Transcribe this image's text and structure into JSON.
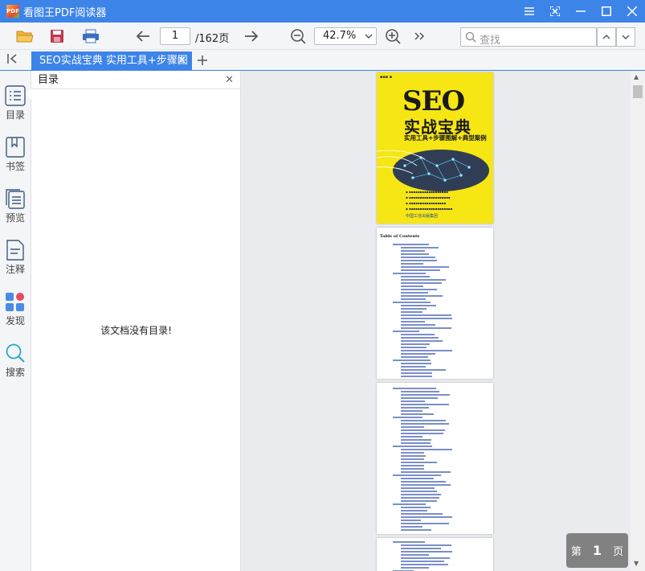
{
  "window": {
    "title": "看图王PDF阅读器",
    "icon_text": "PDF"
  },
  "toolbar": {
    "current_page": "1",
    "total_pages": "/162页",
    "zoom": "42.7%",
    "search_placeholder": "查找"
  },
  "tabs": [
    {
      "label": "SEO实战宝典 实用工具+步骤图"
    }
  ],
  "sidebar": {
    "items": [
      {
        "label": "目录",
        "icon": "list-icon"
      },
      {
        "label": "书签",
        "icon": "bookmark-icon"
      },
      {
        "label": "预览",
        "icon": "pages-icon"
      },
      {
        "label": "注释",
        "icon": "note-icon"
      },
      {
        "label": "发现",
        "icon": "apps-icon"
      },
      {
        "label": "搜索",
        "icon": "search-icon"
      }
    ]
  },
  "toc_panel": {
    "title": "目录",
    "empty_message": "该文档没有目录!"
  },
  "document": {
    "cover_title": "SEO",
    "cover_subtitle": "实战宝典",
    "cover_tagline": "实用工具+步骤图解+典型案例",
    "cover_publisher": "中国工信出版集团",
    "toc_heading": "Table of Contents"
  },
  "page_indicator": {
    "prefix": "第",
    "number": "1",
    "suffix": "页"
  },
  "colors": {
    "accent": "#3d84e8",
    "cover_yellow": "#f6e614"
  }
}
